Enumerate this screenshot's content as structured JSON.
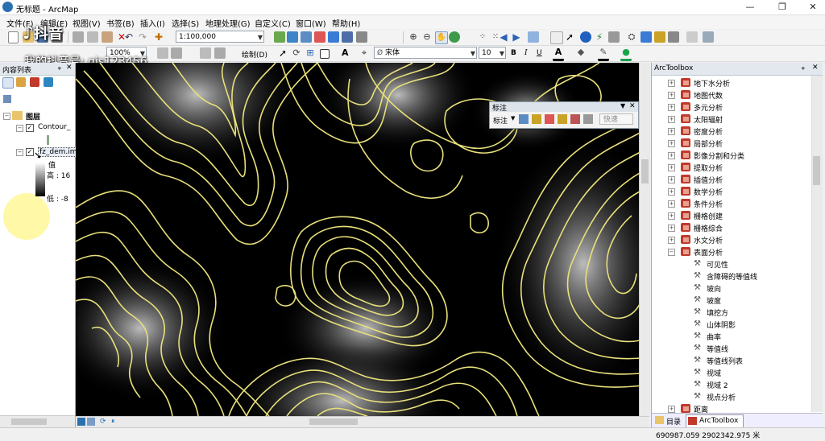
{
  "window": {
    "title": "无标题 - ArcMap",
    "controls": [
      "—",
      "❐",
      "✕"
    ]
  },
  "menu": [
    "文件(F)",
    "编辑(E)",
    "视图(V)",
    "书签(B)",
    "插入(I)",
    "选择(S)",
    "地理处理(G)",
    "自定义(C)",
    "窗口(W)",
    "帮助(H)"
  ],
  "toolbar": {
    "scale": "1:100,000",
    "zoom_percent": "100%",
    "draw_label": "绘制(D)",
    "font_name": "宋体",
    "font_size": "10",
    "bold": "B",
    "italic": "I",
    "underline": "U",
    "text_tool": "A"
  },
  "watermark": {
    "app": "抖音",
    "account": "我的抖音号: gis123456"
  },
  "toc": {
    "title": "内容列表",
    "root": "图层",
    "layers": [
      {
        "name": "Contour_",
        "checked": true
      },
      {
        "name": "fz_dem.img",
        "checked": true
      }
    ],
    "legend_value_label": "值",
    "high": "高 : 16",
    "low": "低 : -8"
  },
  "label_toolbar": {
    "title": "标注",
    "menu": "标注",
    "quick": "快速"
  },
  "toolbox": {
    "title": "ArcToolbox",
    "toolsets": [
      {
        "label": "地下水分析",
        "expanded": false
      },
      {
        "label": "地图代数",
        "expanded": false
      },
      {
        "label": "多元分析",
        "expanded": false
      },
      {
        "label": "太阳辐射",
        "expanded": false
      },
      {
        "label": "密度分析",
        "expanded": false
      },
      {
        "label": "局部分析",
        "expanded": false
      },
      {
        "label": "影像分割和分类",
        "expanded": false
      },
      {
        "label": "提取分析",
        "expanded": false
      },
      {
        "label": "插值分析",
        "expanded": false
      },
      {
        "label": "数学分析",
        "expanded": false
      },
      {
        "label": "条件分析",
        "expanded": false
      },
      {
        "label": "栅格创建",
        "expanded": false
      },
      {
        "label": "栅格综合",
        "expanded": false
      },
      {
        "label": "水文分析",
        "expanded": false
      },
      {
        "label": "表面分析",
        "expanded": true
      }
    ],
    "surface_tools": [
      "可见性",
      "含障碍的等值线",
      "坡向",
      "坡度",
      "填挖方",
      "山体阴影",
      "曲率",
      "等值线",
      "等值线列表",
      "视域",
      "视域 2",
      "视点分析"
    ],
    "last_toolset": "距离",
    "tabs": [
      "目录",
      "ArcToolbox"
    ]
  },
  "status": {
    "coords": "690987.059  2902342.975 米"
  },
  "colors": {
    "contour": "#e8e07a",
    "map_bg": "#000000"
  }
}
